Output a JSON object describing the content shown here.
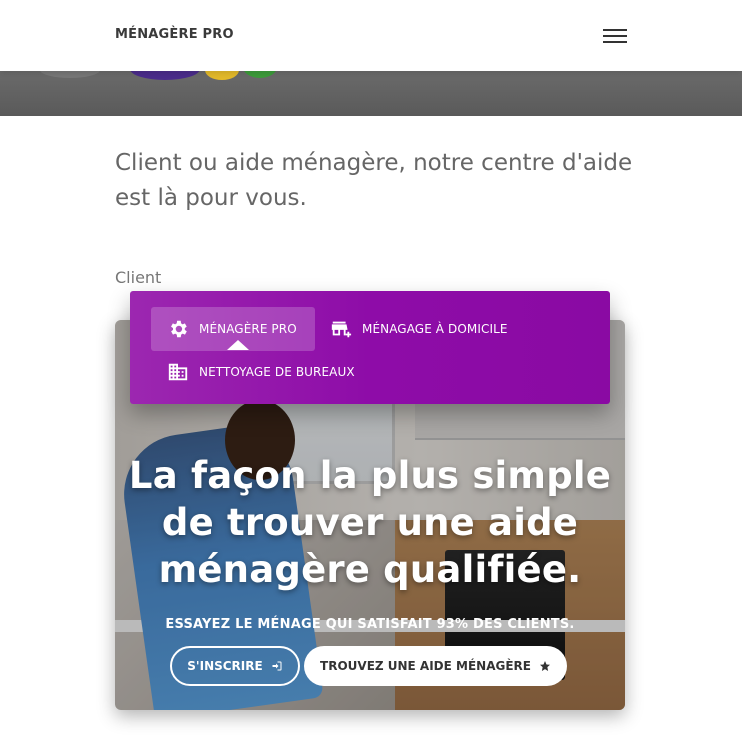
{
  "navbar": {
    "brand": "MÉNAGÈRE PRO",
    "menu_icon": "hamburger-menu-icon"
  },
  "intro": {
    "text": "Client ou aide ménagère, notre centre d'aide est là pour vous."
  },
  "section": {
    "label": "Client"
  },
  "dropdown": {
    "items": [
      {
        "label": "MÉNAGÈRE PRO",
        "icon": "gear-icon",
        "active": true
      },
      {
        "label": "MÉNAGAGE À DOMICILE",
        "icon": "store-add-icon",
        "active": false
      },
      {
        "label": "NETTOYAGE DE BUREAUX",
        "icon": "building-icon",
        "active": false
      }
    ],
    "color": "#9c27b0"
  },
  "hero": {
    "headline": "La façon la plus simple de trouver une aide ménagère qualifiée.",
    "tagline": "ESSAYEZ LE MÉNAGE QUI SATISFAIT 93% DES CLIENTS.",
    "signup_label": "S'INSCRIRE",
    "signup_icon": "login-icon",
    "find_label": "TROUVEZ UNE AIDE MÉNAGÈRE",
    "find_icon": "star-icon"
  }
}
